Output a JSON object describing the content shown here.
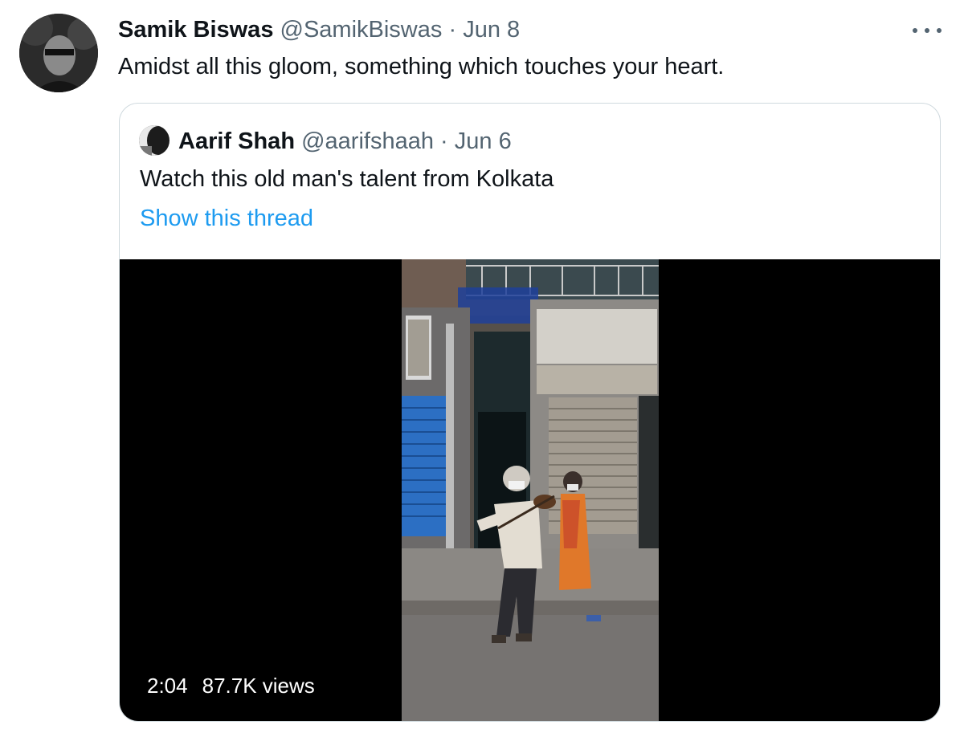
{
  "tweet": {
    "author_name": "Samik Biswas",
    "author_handle": "@SamikBiswas",
    "separator": "·",
    "date": "Jun 8",
    "text": "Amidst all this gloom, something which touches your heart.",
    "more_icon": "more-horizontal-icon"
  },
  "quoted_tweet": {
    "author_name": "Aarif Shah",
    "author_handle": "@aarifshaah",
    "separator": "·",
    "date": "Jun 6",
    "text": "Watch this old man's talent from Kolkata",
    "thread_link": "Show this thread",
    "video": {
      "duration": "2:04",
      "views": "87.7K views"
    }
  },
  "colors": {
    "text": "#0f1419",
    "secondary": "#536471",
    "link": "#1d9bf0",
    "border": "#cfd9de",
    "video_bg": "#000000"
  }
}
